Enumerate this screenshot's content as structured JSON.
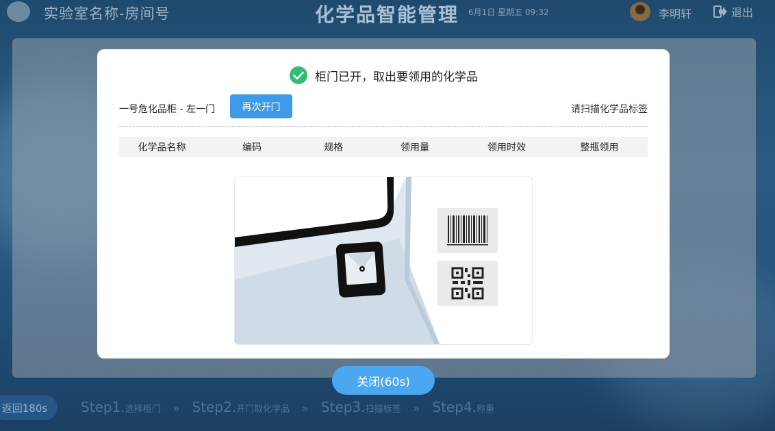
{
  "header": {
    "lab_name": "实验室名称-房间号",
    "app_title": "化学品智能管理",
    "datetime": "6月1日 星期五 09:32",
    "user_name": "李明轩",
    "logout_label": "退出"
  },
  "modal": {
    "title": "柜门已开，取出要领用的化学品",
    "cabinet_label": "一号危化品柜 - 左一门",
    "reopen_label": "再次开门",
    "scan_hint": "请扫描化学品标签",
    "columns": [
      "化学品名称",
      "编码",
      "规格",
      "领用量",
      "领用时效",
      "整瓶领用"
    ]
  },
  "close_label": "关闭(60s)",
  "footer": {
    "back_label": "返回180s",
    "steps": [
      {
        "big": "Step1.",
        "small": "选择柜门"
      },
      {
        "big": "Step2.",
        "small": "开门取化学品"
      },
      {
        "big": "Step3.",
        "small": "扫描标签"
      },
      {
        "big": "Step4.",
        "small": "称重"
      }
    ],
    "separator": "»"
  },
  "colors": {
    "accent": "#3d9ae8",
    "success": "#2fbf71"
  }
}
